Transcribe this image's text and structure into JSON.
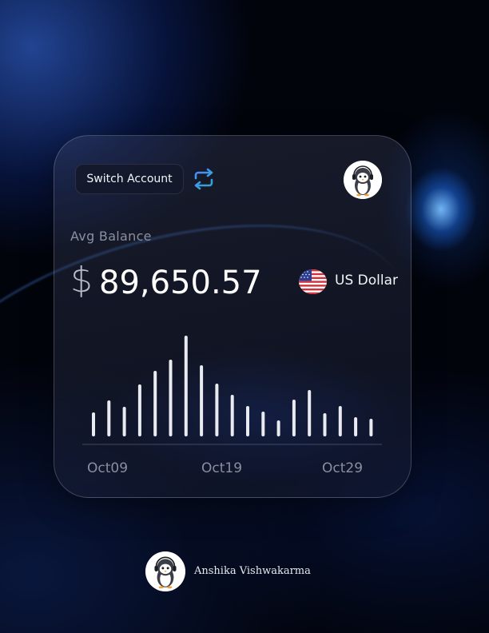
{
  "switch_account": {
    "label": "Switch Account"
  },
  "balance": {
    "label": "Avg Balance",
    "currency_symbol": "$",
    "amount": "89,650.57",
    "currency_name": "US Dollar"
  },
  "chart_data": {
    "type": "bar",
    "x_tick_labels": [
      "Oct09",
      "Oct19",
      "Oct29"
    ],
    "values": [
      30,
      45,
      37,
      65,
      82,
      96,
      126,
      89,
      66,
      52,
      38,
      31,
      20,
      46,
      58,
      29,
      38,
      24,
      22
    ],
    "bar_color": "#e9ebf1",
    "grid": false
  },
  "author": {
    "name": "Anshika Vishwakarma"
  },
  "colors": {
    "background": "#020309",
    "accent_blue": "#3f7fff",
    "text_primary": "#ffffff",
    "text_muted": "#8b90a1"
  },
  "icons": {
    "swap": "swap-arrows-icon",
    "flag": "us-flag-icon",
    "avatar": "penguin-avatar-icon"
  }
}
